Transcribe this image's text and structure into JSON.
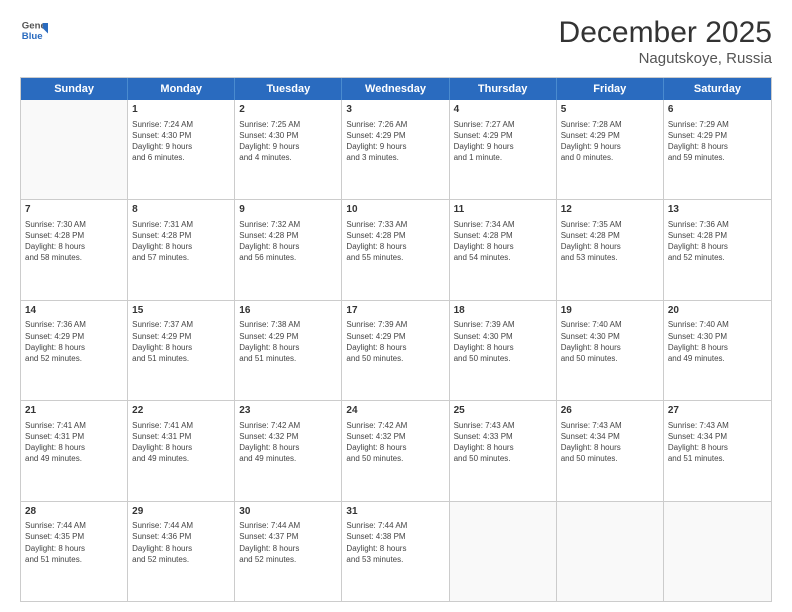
{
  "header": {
    "logo_line1": "General",
    "logo_line2": "Blue",
    "title": "December 2025",
    "subtitle": "Nagutskoye, Russia"
  },
  "days": [
    "Sunday",
    "Monday",
    "Tuesday",
    "Wednesday",
    "Thursday",
    "Friday",
    "Saturday"
  ],
  "weeks": [
    [
      {
        "date": "",
        "info": ""
      },
      {
        "date": "1",
        "info": "Sunrise: 7:24 AM\nSunset: 4:30 PM\nDaylight: 9 hours\nand 6 minutes."
      },
      {
        "date": "2",
        "info": "Sunrise: 7:25 AM\nSunset: 4:30 PM\nDaylight: 9 hours\nand 4 minutes."
      },
      {
        "date": "3",
        "info": "Sunrise: 7:26 AM\nSunset: 4:29 PM\nDaylight: 9 hours\nand 3 minutes."
      },
      {
        "date": "4",
        "info": "Sunrise: 7:27 AM\nSunset: 4:29 PM\nDaylight: 9 hours\nand 1 minute."
      },
      {
        "date": "5",
        "info": "Sunrise: 7:28 AM\nSunset: 4:29 PM\nDaylight: 9 hours\nand 0 minutes."
      },
      {
        "date": "6",
        "info": "Sunrise: 7:29 AM\nSunset: 4:29 PM\nDaylight: 8 hours\nand 59 minutes."
      }
    ],
    [
      {
        "date": "7",
        "info": "Sunrise: 7:30 AM\nSunset: 4:28 PM\nDaylight: 8 hours\nand 58 minutes."
      },
      {
        "date": "8",
        "info": "Sunrise: 7:31 AM\nSunset: 4:28 PM\nDaylight: 8 hours\nand 57 minutes."
      },
      {
        "date": "9",
        "info": "Sunrise: 7:32 AM\nSunset: 4:28 PM\nDaylight: 8 hours\nand 56 minutes."
      },
      {
        "date": "10",
        "info": "Sunrise: 7:33 AM\nSunset: 4:28 PM\nDaylight: 8 hours\nand 55 minutes."
      },
      {
        "date": "11",
        "info": "Sunrise: 7:34 AM\nSunset: 4:28 PM\nDaylight: 8 hours\nand 54 minutes."
      },
      {
        "date": "12",
        "info": "Sunrise: 7:35 AM\nSunset: 4:28 PM\nDaylight: 8 hours\nand 53 minutes."
      },
      {
        "date": "13",
        "info": "Sunrise: 7:36 AM\nSunset: 4:28 PM\nDaylight: 8 hours\nand 52 minutes."
      }
    ],
    [
      {
        "date": "14",
        "info": "Sunrise: 7:36 AM\nSunset: 4:29 PM\nDaylight: 8 hours\nand 52 minutes."
      },
      {
        "date": "15",
        "info": "Sunrise: 7:37 AM\nSunset: 4:29 PM\nDaylight: 8 hours\nand 51 minutes."
      },
      {
        "date": "16",
        "info": "Sunrise: 7:38 AM\nSunset: 4:29 PM\nDaylight: 8 hours\nand 51 minutes."
      },
      {
        "date": "17",
        "info": "Sunrise: 7:39 AM\nSunset: 4:29 PM\nDaylight: 8 hours\nand 50 minutes."
      },
      {
        "date": "18",
        "info": "Sunrise: 7:39 AM\nSunset: 4:30 PM\nDaylight: 8 hours\nand 50 minutes."
      },
      {
        "date": "19",
        "info": "Sunrise: 7:40 AM\nSunset: 4:30 PM\nDaylight: 8 hours\nand 50 minutes."
      },
      {
        "date": "20",
        "info": "Sunrise: 7:40 AM\nSunset: 4:30 PM\nDaylight: 8 hours\nand 49 minutes."
      }
    ],
    [
      {
        "date": "21",
        "info": "Sunrise: 7:41 AM\nSunset: 4:31 PM\nDaylight: 8 hours\nand 49 minutes."
      },
      {
        "date": "22",
        "info": "Sunrise: 7:41 AM\nSunset: 4:31 PM\nDaylight: 8 hours\nand 49 minutes."
      },
      {
        "date": "23",
        "info": "Sunrise: 7:42 AM\nSunset: 4:32 PM\nDaylight: 8 hours\nand 49 minutes."
      },
      {
        "date": "24",
        "info": "Sunrise: 7:42 AM\nSunset: 4:32 PM\nDaylight: 8 hours\nand 50 minutes."
      },
      {
        "date": "25",
        "info": "Sunrise: 7:43 AM\nSunset: 4:33 PM\nDaylight: 8 hours\nand 50 minutes."
      },
      {
        "date": "26",
        "info": "Sunrise: 7:43 AM\nSunset: 4:34 PM\nDaylight: 8 hours\nand 50 minutes."
      },
      {
        "date": "27",
        "info": "Sunrise: 7:43 AM\nSunset: 4:34 PM\nDaylight: 8 hours\nand 51 minutes."
      }
    ],
    [
      {
        "date": "28",
        "info": "Sunrise: 7:44 AM\nSunset: 4:35 PM\nDaylight: 8 hours\nand 51 minutes."
      },
      {
        "date": "29",
        "info": "Sunrise: 7:44 AM\nSunset: 4:36 PM\nDaylight: 8 hours\nand 52 minutes."
      },
      {
        "date": "30",
        "info": "Sunrise: 7:44 AM\nSunset: 4:37 PM\nDaylight: 8 hours\nand 52 minutes."
      },
      {
        "date": "31",
        "info": "Sunrise: 7:44 AM\nSunset: 4:38 PM\nDaylight: 8 hours\nand 53 minutes."
      },
      {
        "date": "",
        "info": ""
      },
      {
        "date": "",
        "info": ""
      },
      {
        "date": "",
        "info": ""
      }
    ]
  ]
}
